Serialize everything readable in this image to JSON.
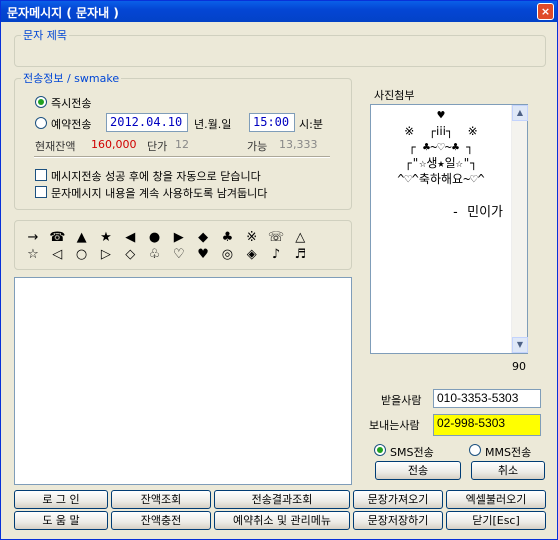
{
  "window": {
    "title": "문자메시지 ( 문자내 )",
    "close_icon": "×"
  },
  "subject": {
    "legend": "문자 제목",
    "value": ""
  },
  "send_info": {
    "legend": "전송정보 / swmake",
    "immediate_label": "즉시전송",
    "reserve_label": "예약전송",
    "date": "2012.04.10",
    "date_unit": "년.월.일",
    "time": "15:00",
    "time_unit": "시:분",
    "balance_label": "현재잔액",
    "balance_value": "160,000",
    "unit_price_label": "단가",
    "unit_price_value": "12",
    "possible_label": "가능",
    "possible_value": "13,333",
    "auto_close_label": "메시지전송 성공 후에 창을 자동으로 닫습니다",
    "keep_text_label": "문자메시지 내용을 계속 사용하도록 남겨둡니다"
  },
  "symbols": {
    "row1": [
      "→",
      "☎",
      "▲",
      "★",
      "◀",
      "●",
      "▶",
      "◆",
      "♣",
      "※",
      "☏",
      "△"
    ],
    "row2": [
      "☆",
      "◁",
      "○",
      "▷",
      "◇",
      "♧",
      "♡",
      "♥",
      "◎",
      "◈",
      "♪",
      "♬"
    ]
  },
  "message": {
    "value": ""
  },
  "photo": {
    "legend": "사진첨부",
    "art_lines": [
      "♥",
      "※  ┌ⅰⅰⅰ┐  ※",
      "┌ ♣~♡~♣ ┐",
      "┌\"☆생★일☆\"┐",
      "^♡^축하해요~♡^",
      "",
      "- 민이가"
    ],
    "byte_count": "90"
  },
  "recipient": {
    "label": "받을사람",
    "value": "010-3353-5303"
  },
  "sender": {
    "label": "보내는사람",
    "value": "02-998-5303"
  },
  "type": {
    "sms_label": "SMS전송",
    "mms_label": "MMS전송"
  },
  "actions": {
    "send": "전송",
    "cancel": "취소"
  },
  "bottom_buttons": {
    "login": "로 그 인",
    "balance_check": "잔액조회",
    "result_check": "전송결과조회",
    "load_text": "문장가져오기",
    "load_excel": "엑셀불러오기",
    "help": "도 움 말",
    "recharge": "잔액충전",
    "reserve_manage": "예약취소 및 관리메뉴",
    "save_text": "문장저장하기",
    "close": "닫기[Esc]"
  },
  "colors": {
    "title_bar": "#0446d4",
    "legend": "#0046d5",
    "balance": "#d00000",
    "sender_bg": "#ffff00"
  }
}
